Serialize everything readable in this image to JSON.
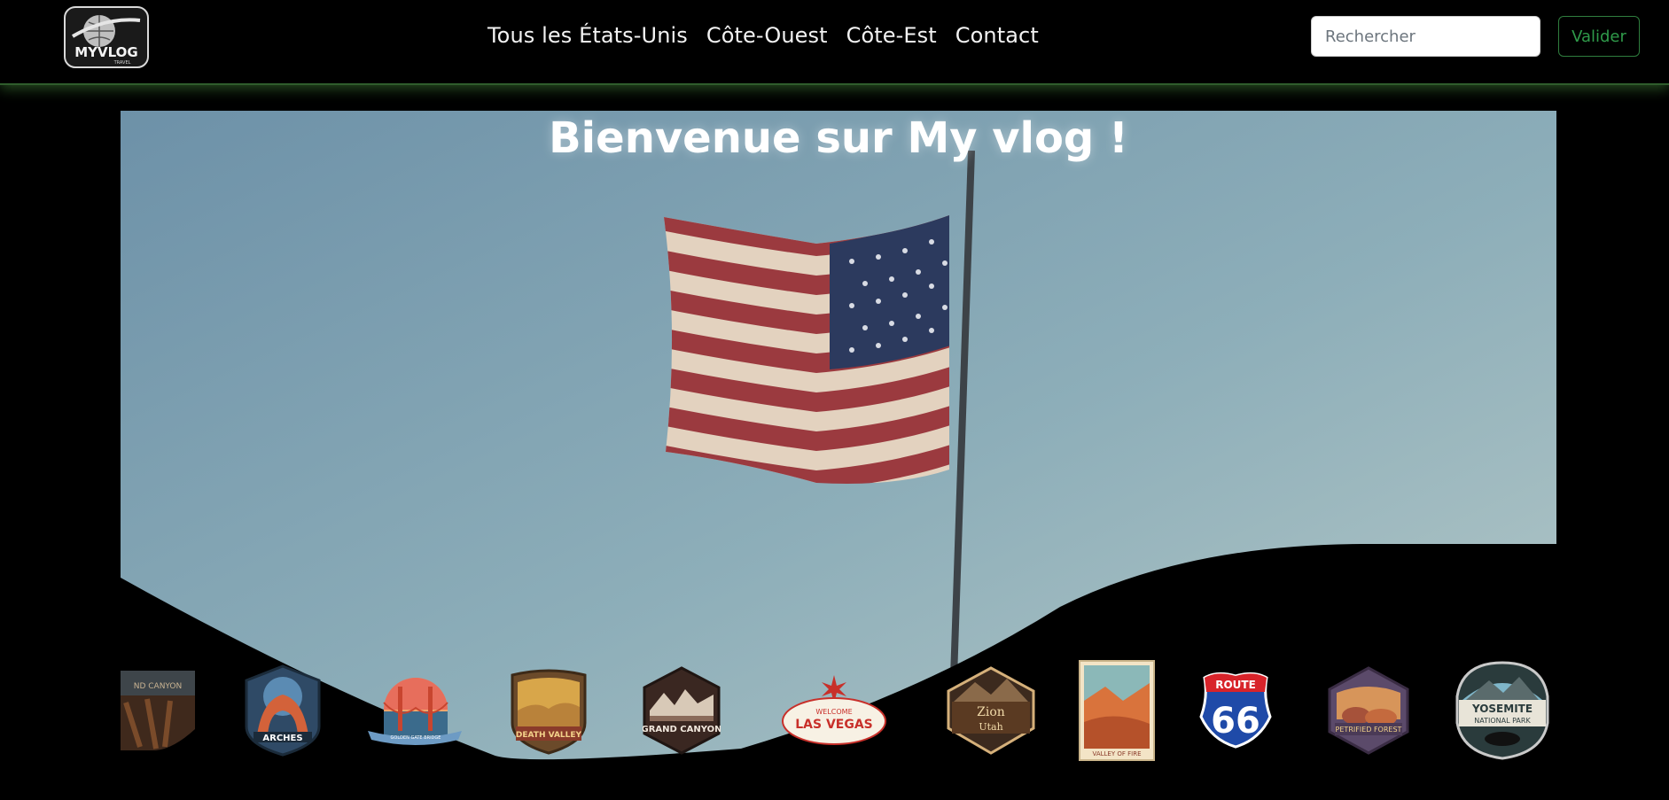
{
  "header": {
    "logo_text": "MYVLOG",
    "logo_subtext": "TRAVEL",
    "nav": [
      {
        "label": "Tous les États-Unis"
      },
      {
        "label": "Côte-Ouest"
      },
      {
        "label": "Côte-Est"
      },
      {
        "label": "Contact"
      }
    ],
    "search_placeholder": "Rechercher",
    "submit_label": "Valider"
  },
  "hero": {
    "title": "Bienvenue sur My vlog !",
    "background": "Drapeau américain au vent sur ciel bleu"
  },
  "badges": [
    {
      "name": "Grand Canyon National Park (partiel)",
      "text": "ND CANYON"
    },
    {
      "name": "Arches",
      "text": "ARCHES"
    },
    {
      "name": "Golden Gate Bridge",
      "text": "GOLDEN GATE BRIDGE"
    },
    {
      "name": "Death Valley",
      "text": "DEATH VALLEY"
    },
    {
      "name": "Grand Canyon",
      "text": "GRAND CANYON"
    },
    {
      "name": "Las Vegas",
      "text": "LAS VEGAS"
    },
    {
      "name": "Zion Utah",
      "text": "Zion"
    },
    {
      "name": "Valley of Fire",
      "text": "VALLEY OF FIRE"
    },
    {
      "name": "Route 66",
      "text": "66"
    },
    {
      "name": "Petrified Forest",
      "text": "PETRIFIED FOREST"
    },
    {
      "name": "Yosemite",
      "text": "YOSEMITE"
    }
  ],
  "colors": {
    "sky_top": "#6f93a8",
    "sky_bottom": "#a7c1c9",
    "accent_green": "#2f9a4a",
    "flag_red": "#9b3a3f",
    "flag_blue": "#2c3a5e"
  }
}
